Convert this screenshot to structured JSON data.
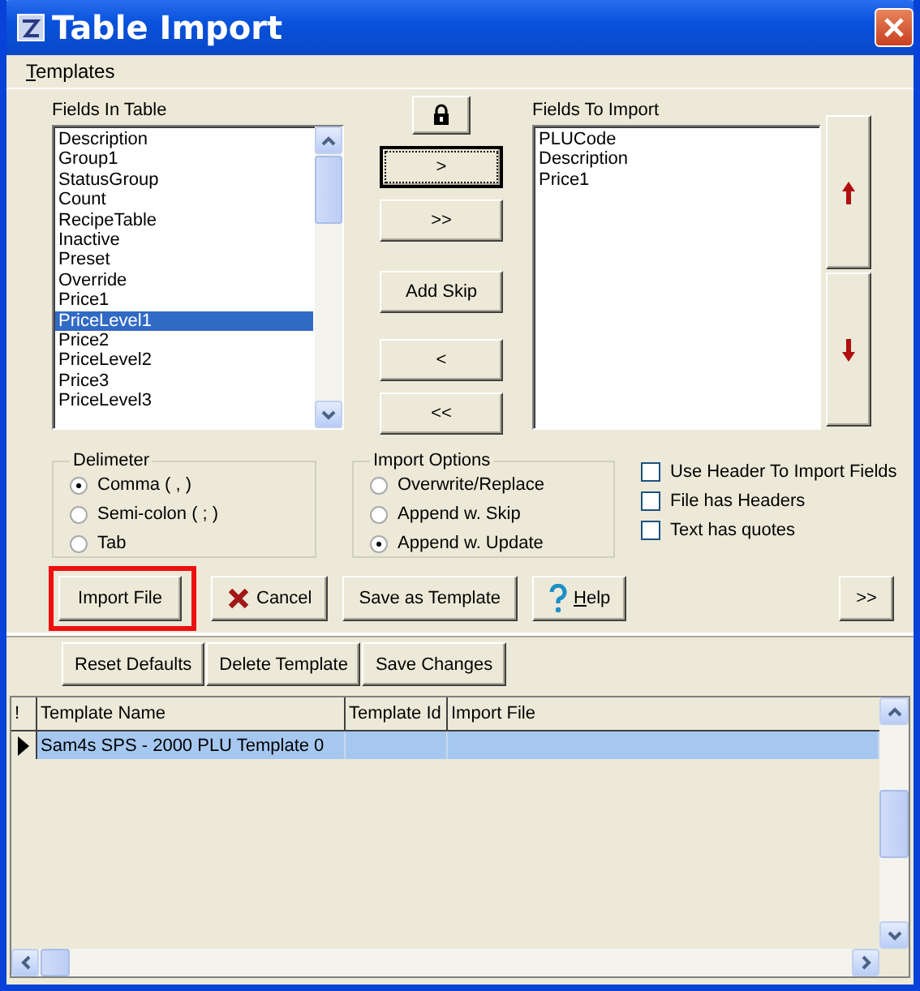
{
  "window": {
    "title": "Table Import"
  },
  "menu": [
    {
      "label": "Templates"
    }
  ],
  "fields_in_table": {
    "label": "Fields In Table",
    "items": [
      {
        "label": "Description",
        "selected": false
      },
      {
        "label": "Group1",
        "selected": false
      },
      {
        "label": "StatusGroup",
        "selected": false
      },
      {
        "label": "Count",
        "selected": false
      },
      {
        "label": "RecipeTable",
        "selected": false
      },
      {
        "label": "Inactive",
        "selected": false
      },
      {
        "label": "Preset",
        "selected": false
      },
      {
        "label": "Override",
        "selected": false
      },
      {
        "label": "Price1",
        "selected": false
      },
      {
        "label": "PriceLevel1",
        "selected": true
      },
      {
        "label": "Price2",
        "selected": false
      },
      {
        "label": "PriceLevel2",
        "selected": false
      },
      {
        "label": "Price3",
        "selected": false
      },
      {
        "label": "PriceLevel3",
        "selected": false
      }
    ]
  },
  "transfer_buttons": [
    {
      "label": ">",
      "focused": true
    },
    {
      "label": ">>",
      "focused": false
    },
    {
      "label": "Add Skip",
      "focused": false
    },
    {
      "label": "<",
      "focused": false
    },
    {
      "label": "<<",
      "focused": false
    }
  ],
  "fields_to_import": {
    "label": "Fields To Import",
    "items": [
      {
        "label": "PLUCode",
        "selected": false
      },
      {
        "label": "Description",
        "selected": false
      },
      {
        "label": "Price1",
        "selected": false
      }
    ]
  },
  "delimeter": {
    "label": "Delimeter",
    "options": [
      {
        "label": "Comma ( , )",
        "selected": true
      },
      {
        "label": "Semi-colon ( ; )",
        "selected": false
      },
      {
        "label": "Tab",
        "selected": false
      }
    ]
  },
  "import_options": {
    "label": "Import Options",
    "options": [
      {
        "label": "Overwrite/Replace",
        "selected": false
      },
      {
        "label": "Append w. Skip",
        "selected": false
      },
      {
        "label": "Append w. Update",
        "selected": true
      }
    ]
  },
  "checkboxes": [
    {
      "label": "Use Header To Import Fields",
      "checked": false
    },
    {
      "label": "File has Headers",
      "checked": false
    },
    {
      "label": "Text has quotes",
      "checked": false
    }
  ],
  "action_buttons": [
    {
      "label": "Import File",
      "kind": "plain",
      "highlighted": true
    },
    {
      "label": "Cancel",
      "kind": "cancel",
      "highlighted": false
    },
    {
      "label": "Save as Template",
      "kind": "plain",
      "highlighted": false
    },
    {
      "label": "Help",
      "kind": "help",
      "highlighted": false
    }
  ],
  "more_button": {
    "label": ">>"
  },
  "template_buttons": [
    {
      "label": "Reset Defaults"
    },
    {
      "label": "Delete Template"
    },
    {
      "label": "Save Changes"
    }
  ],
  "grid": {
    "columns": [
      "!",
      "Template Name",
      "Template Id",
      "Import File"
    ],
    "rows": [
      {
        "template_name": "Sam4s SPS - 2000 PLU Template 0",
        "selected": true
      }
    ]
  }
}
